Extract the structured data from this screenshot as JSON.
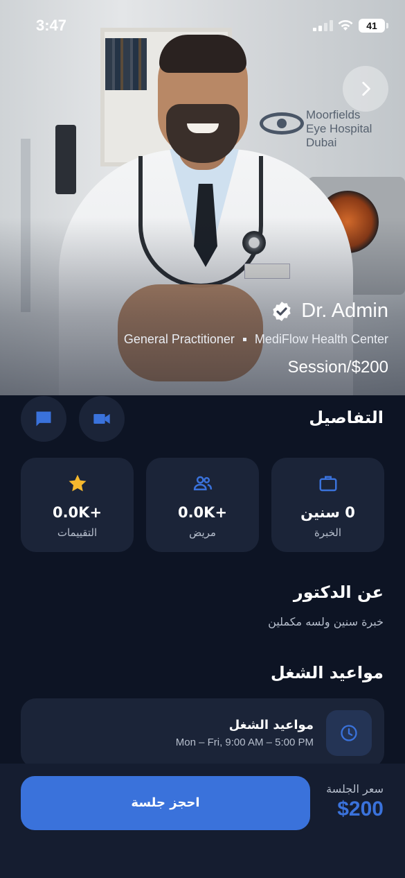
{
  "status_bar": {
    "time": "3:47",
    "battery": "41"
  },
  "doctor": {
    "name": "Dr. Admin",
    "specialty": "General Practitioner",
    "center": "MediFlow Health Center",
    "price_per_session": "Session/$200",
    "verified": true
  },
  "actions": {
    "chat_icon": "chat-icon",
    "video_icon": "video-call-icon",
    "next_icon": "chevron-right-icon"
  },
  "details": {
    "title": "التفاصيل",
    "stats": [
      {
        "icon": "star-icon",
        "value": "+0.0K",
        "label": "التقييمات"
      },
      {
        "icon": "patients-icon",
        "value": "+0.0K",
        "label": "مريض"
      },
      {
        "icon": "briefcase-icon",
        "value": "0 سنين",
        "label": "الخبرة"
      }
    ]
  },
  "about": {
    "title": "عن الدكتور",
    "text": "خبرة سنين ولسه مكملين"
  },
  "working_hours": {
    "title": "مواعيد الشغل",
    "card_title": "مواعيد الشغل",
    "schedule": "Mon – Fri, 9:00 AM – 5:00 PM"
  },
  "bottom": {
    "price_label": "سعر الجلسة",
    "price": "$200",
    "book_label": "احجز جلسة"
  },
  "colors": {
    "accent": "#3a72db",
    "background": "#0d1424",
    "card": "#1b2438",
    "star": "#f5b82e"
  }
}
